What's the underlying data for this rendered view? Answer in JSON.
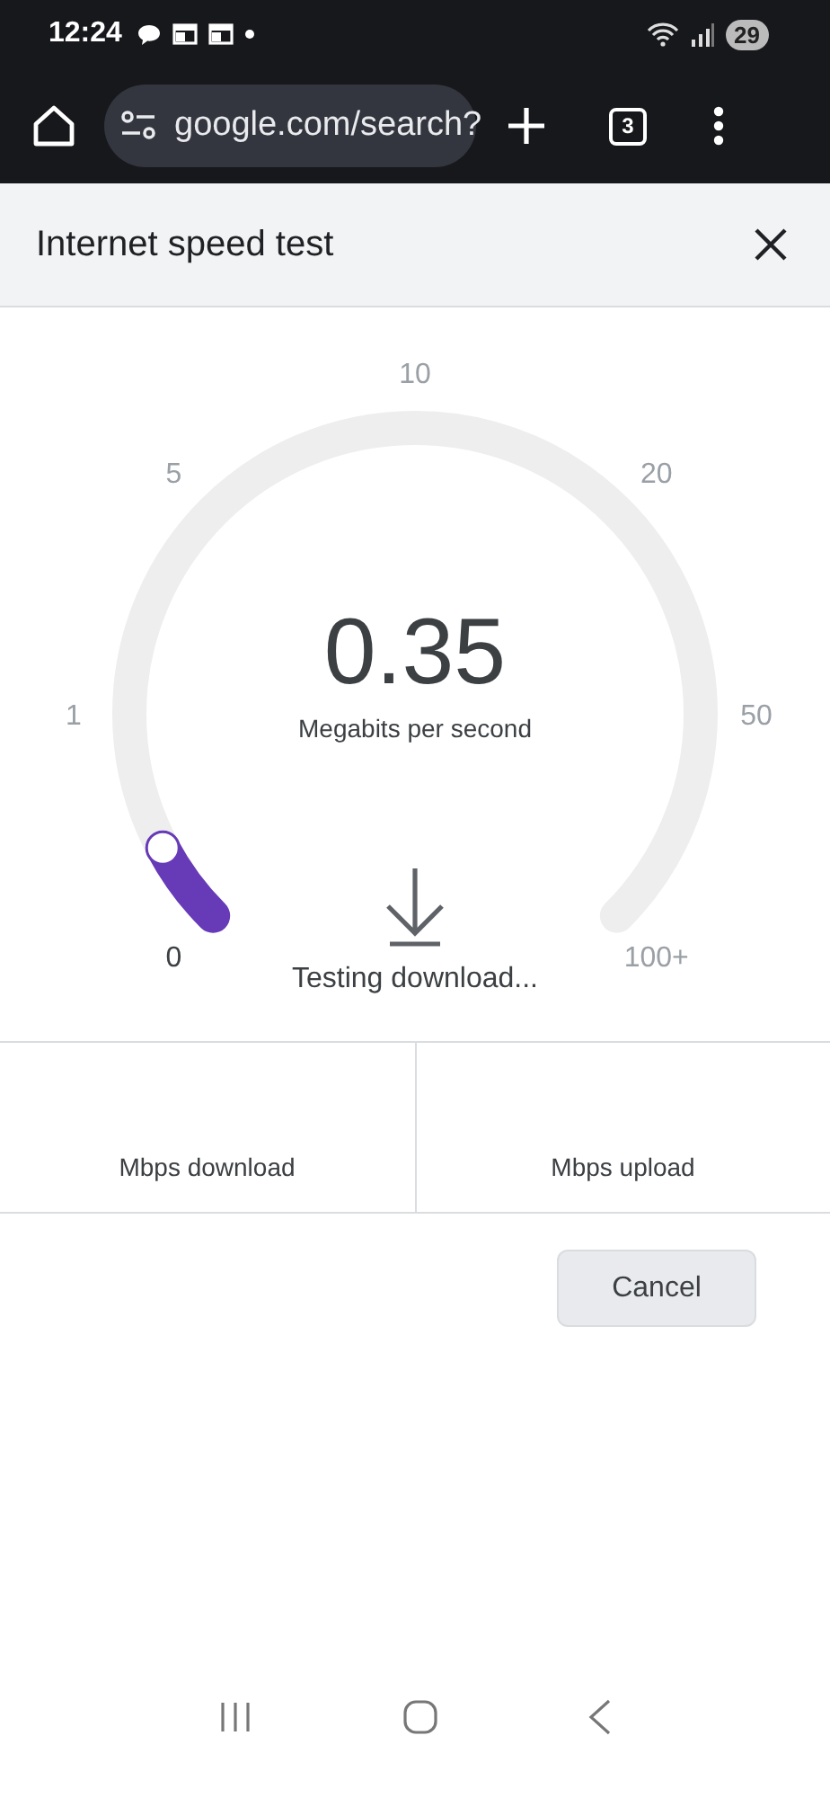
{
  "status_bar": {
    "time": "12:24",
    "battery": "29"
  },
  "toolbar": {
    "url": "google.com/search?",
    "tab_count": "3"
  },
  "dialog": {
    "title": "Internet speed test"
  },
  "gauge": {
    "ticks": [
      "0",
      "1",
      "5",
      "10",
      "20",
      "50",
      "100+"
    ],
    "value": "0.35",
    "unit": "Megabits per second",
    "status": "Testing download..."
  },
  "stats": [
    {
      "label": "Mbps download"
    },
    {
      "label": "Mbps upload"
    }
  ],
  "buttons": [
    {
      "label": "Cancel"
    }
  ]
}
